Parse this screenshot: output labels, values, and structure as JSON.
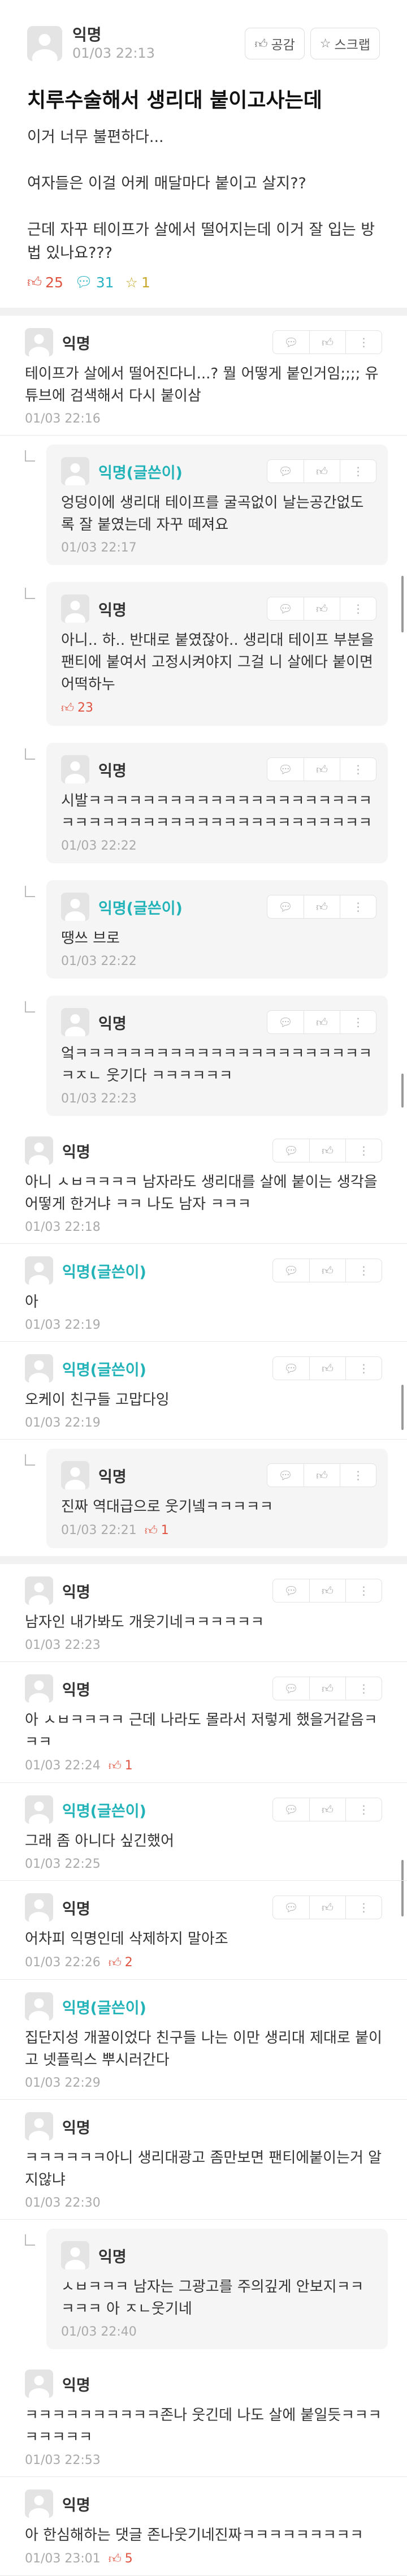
{
  "post": {
    "author": "익명",
    "date": "01/03 22:13",
    "like_button": "공감",
    "scrap_button": "스크랩",
    "title": "치루수술해서 생리대 붙이고사는데",
    "body": "이거 너무 불편하다...\n\n여자들은 이걸 어케 매달마다 붙이고 살지??\n\n근데 자꾸 테이프가 살에서 떨어지는데 이거 잘 입는 방법 있나요???",
    "likes": "25",
    "comments": "31",
    "scraps": "1"
  },
  "icons": {
    "like": "thumbs-up-icon",
    "comment": "speech-bubble-icon",
    "scrap": "star-icon",
    "more": "more-vertical-icon"
  },
  "comments": [
    {
      "author": "익명",
      "op": false,
      "reply": false,
      "text": "테이프가 살에서 떨어진다니...? 뭘 어떻게 붙인거임;;;; 유튜브에 검색해서 다시 붙이삼",
      "time": "01/03 22:16",
      "likes": ""
    },
    {
      "author": "익명(글쓴이)",
      "op": true,
      "reply": true,
      "text": "엉덩이에 생리대 테이프를 굴곡없이 날는공간없도록 잘 붙였는데 자꾸 떼져요",
      "time": "01/03 22:17",
      "likes": ""
    },
    {
      "author": "익명",
      "op": false,
      "reply": true,
      "text": "아니.. 하.. 반대로 붙였잖아.. 생리대 테이프 부분을 팬티에 붙여서 고정시켜야지 그걸 니 살에다 붙이면 어떡하누",
      "time": "",
      "likes": "23"
    },
    {
      "author": "익명",
      "op": false,
      "reply": true,
      "text": "시발ㅋㅋㅋㅋㅋㅋㅋㅋㅋㅋㅋㅋㅋㅋㅋㅋㅋㅋㅋㅋㅋㅋㅋㅋㅋㅋㅋㅋㅋㅋㅋㅋㅋㅋㅋㅋㅋㅋㅋㅋㅋㅋㅋㅋ",
      "time": "01/03 22:22",
      "likes": ""
    },
    {
      "author": "익명(글쓴이)",
      "op": true,
      "reply": true,
      "text": "땡쓰 브로",
      "time": "01/03 22:22",
      "likes": ""
    },
    {
      "author": "익명",
      "op": false,
      "reply": true,
      "text": "엌ㅋㅋㅋㅋㅋㅋㅋㅋㅋㅋㅋㅋㅋㅋㅋㅋㅋㅋㅋㅋㅋㅋㅋㅈㄴ 웃기다 ㅋㅋㅋㅋㅋㅋ",
      "time": "01/03 22:23",
      "likes": ""
    },
    {
      "author": "익명",
      "op": false,
      "reply": false,
      "text": "아니 ㅅㅂㅋㅋㅋㅋ 남자라도 생리대를 살에 붙이는 생각을 어떻게 한거냐 ㅋㅋ 나도 남자 ㅋㅋㅋ",
      "time": "01/03 22:18",
      "likes": ""
    },
    {
      "author": "익명(글쓴이)",
      "op": true,
      "reply": false,
      "text": "아",
      "time": "01/03 22:19",
      "likes": ""
    },
    {
      "author": "익명(글쓴이)",
      "op": true,
      "reply": false,
      "text": "오케이 친구들 고맙다잉",
      "time": "01/03 22:19",
      "likes": ""
    },
    {
      "author": "익명",
      "op": false,
      "reply": true,
      "text": "진짜 역대급으로 웃기넼ㅋㅋㅋㅋㅋ",
      "time": "01/03 22:21",
      "likes": "1"
    },
    {
      "author": "익명",
      "op": false,
      "reply": false,
      "text": "남자인 내가봐도 개웃기네ㅋㅋㅋㅋㅋㅋ",
      "time": "01/03 22:23",
      "likes": "",
      "thick": true
    },
    {
      "author": "익명",
      "op": false,
      "reply": false,
      "text": "아 ㅅㅂㅋㅋㅋㅋ 근데 나라도 몰라서 저렇게 했을거같음ㅋㅋㅋ",
      "time": "01/03 22:24",
      "likes": "1"
    },
    {
      "author": "익명(글쓴이)",
      "op": true,
      "reply": false,
      "text": "그래 좀 아니다 싶긴했어",
      "time": "01/03 22:25",
      "likes": ""
    },
    {
      "author": "익명",
      "op": false,
      "reply": false,
      "text": "어차피 익명인데 삭제하지 말아조",
      "time": "01/03 22:26",
      "likes": "2"
    },
    {
      "author": "익명(글쓴이)",
      "op": true,
      "reply": false,
      "text": "집단지성 개꿀이었다 친구들 나는 이만 생리대 제대로 붙이고 넷플릭스 뿌시러간다",
      "time": "01/03 22:29",
      "likes": "",
      "noactions": true
    },
    {
      "author": "익명",
      "op": false,
      "reply": false,
      "text": "ㅋㅋㅋㅋㅋㅋ아니 생리대광고 좀만보면 팬티에붙이는거 알지않냐",
      "time": "01/03 22:30",
      "likes": "",
      "noactions": true
    },
    {
      "author": "익명",
      "op": false,
      "reply": true,
      "text": "ㅅㅂㅋㅋㅋ 남자는 그광고를 주의깊게 안보지ㅋㅋㅋㅋㅋ 아 ㅈㄴ웃기네",
      "time": "01/03 22:40",
      "likes": "",
      "noactions": true
    },
    {
      "author": "익명",
      "op": false,
      "reply": false,
      "text": "ㅋㅋㅋㅋㅋㅋㅋㅋㅋㅋ존나 웃긴데 나도 살에 붙일듯ㅋㅋㅋㅋㅋㅋㅋㅋ",
      "time": "01/03 22:53",
      "likes": "",
      "noactions": true
    },
    {
      "author": "익명",
      "op": false,
      "reply": false,
      "text": "아 한심해하는 댓글 존나웃기네진짜ㅋㅋㅋㅋㅋㅋㅋㅋㅋ",
      "time": "01/03 23:01",
      "likes": "5",
      "noactions": true
    }
  ]
}
